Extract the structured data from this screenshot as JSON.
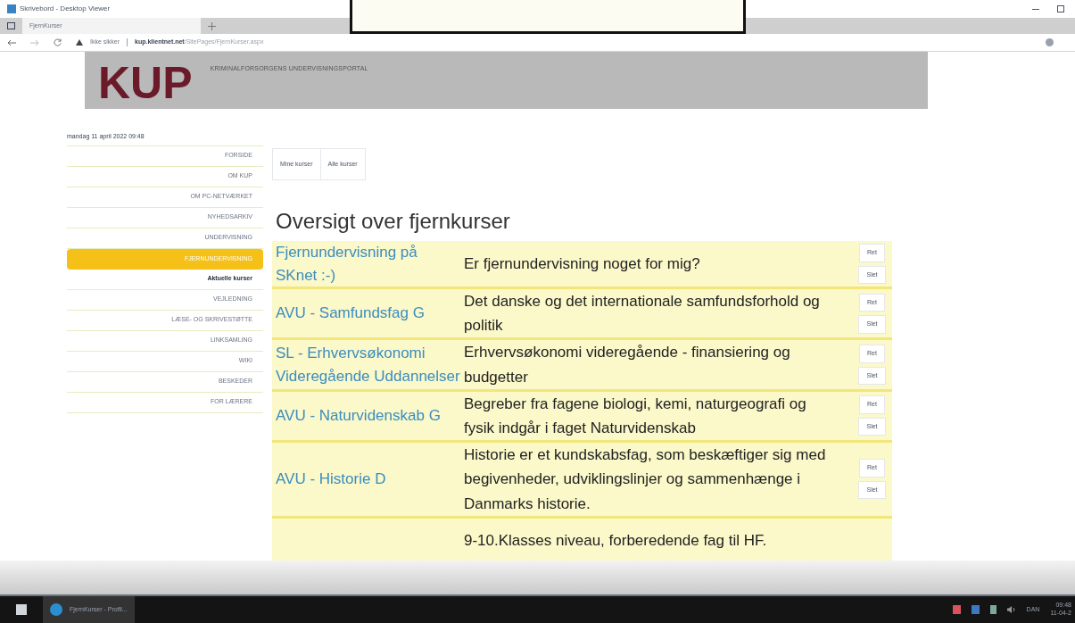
{
  "viewer": {
    "title": "Skrivebord - Desktop Viewer"
  },
  "browser": {
    "tabs": [
      {
        "label": "FjernKurser",
        "selected": true
      }
    ],
    "security": "Ikke sikker",
    "url_host": "kup.klientnet.net",
    "url_path": "/SitePages/FjernKurser.aspx"
  },
  "header": {
    "logo": "KUP",
    "subtitle": "KRIMINALFORSORGENS UNDERVISNINGSPORTAL"
  },
  "sidebar": {
    "date": "mandag 11 april 2022 09:48",
    "items": [
      {
        "label": "FORSIDE",
        "selected": false,
        "kind": "main"
      },
      {
        "label": "OM KUP",
        "selected": false,
        "kind": "main"
      },
      {
        "label": "OM PC-NETVÆRKET",
        "selected": false,
        "kind": "main"
      },
      {
        "label": "NYHEDSARKIV",
        "selected": false,
        "kind": "main"
      },
      {
        "label": "UNDERVISNING",
        "selected": false,
        "kind": "main"
      },
      {
        "label": "FJERNUNDERVISNING",
        "selected": true,
        "kind": "main"
      },
      {
        "label": "Aktuelle kurser",
        "selected": false,
        "kind": "sub"
      },
      {
        "label": "VEJLEDNING",
        "selected": false,
        "kind": "main"
      },
      {
        "label": "LÆSE- OG SKRIVESTØTTE",
        "selected": false,
        "kind": "main"
      },
      {
        "label": "LINKSAMLING",
        "selected": false,
        "kind": "main"
      },
      {
        "label": "WIKI",
        "selected": false,
        "kind": "main"
      },
      {
        "label": "BESKEDER",
        "selected": false,
        "kind": "main"
      },
      {
        "label": "FOR LÆRERE",
        "selected": false,
        "kind": "main"
      }
    ]
  },
  "course_tabs": [
    {
      "label": "Mine kurser",
      "selected": false
    },
    {
      "label": "Alle kurser",
      "selected": false
    }
  ],
  "heading": "Oversigt over fjernkurser",
  "courses": [
    {
      "title": "Fjernundervisning på SKnet :-)",
      "description": "Er fjernundervisning noget for mig?",
      "edit": "Ret",
      "delete": "Slet"
    },
    {
      "title": "AVU - Samfundsfag G",
      "description": "Det danske og det internationale samfundsforhold og politik",
      "edit": "Ret",
      "delete": "Slet"
    },
    {
      "title": "SL - Erhvervsøkonomi Videregående Uddannelser",
      "description": "Erhvervsøkonomi videregående - finansiering og budgetter",
      "edit": "Ret",
      "delete": "Slet"
    },
    {
      "title": "AVU - Naturvidenskab G",
      "description": "Begreber fra fagene biologi, kemi, naturgeografi og fysik indgår i faget Naturvidenskab",
      "edit": "Ret",
      "delete": "Slet"
    },
    {
      "title": "AVU - Historie D",
      "description": "Historie er et kundskabsfag, som beskæftiger sig med begivenheder, udviklingslinjer og sammenhænge i Danmarks historie.",
      "edit": "Ret",
      "delete": "Slet"
    },
    {
      "description": "9-10.Klasses niveau, forberedende fag til HF."
    }
  ],
  "taskbar": {
    "app": "FjernKurser - Profil...",
    "language": "DAN",
    "time": "09:48",
    "date": "11-04-2"
  }
}
